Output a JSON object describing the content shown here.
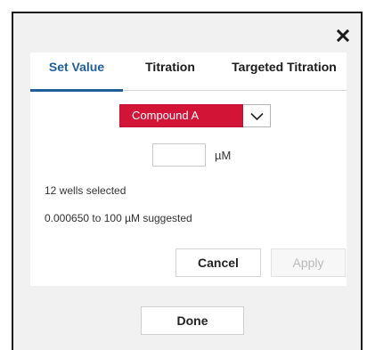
{
  "dialog": {
    "close_icon": "close-icon",
    "tabs": [
      {
        "label": "Set Value",
        "active": true
      },
      {
        "label": "Titration",
        "active": false
      },
      {
        "label": "Targeted Titration",
        "active": false
      }
    ],
    "compound_select": {
      "selected": "Compound A",
      "color": "#d21437",
      "arrow_icon": "chevron-down-icon"
    },
    "value_input": {
      "value": "",
      "placeholder": ""
    },
    "unit": "µM",
    "wells_selected": "12 wells selected",
    "suggested_range": "0.000650 to 100 µM suggested",
    "cancel_label": "Cancel",
    "apply_label": "Apply",
    "done_label": "Done"
  }
}
